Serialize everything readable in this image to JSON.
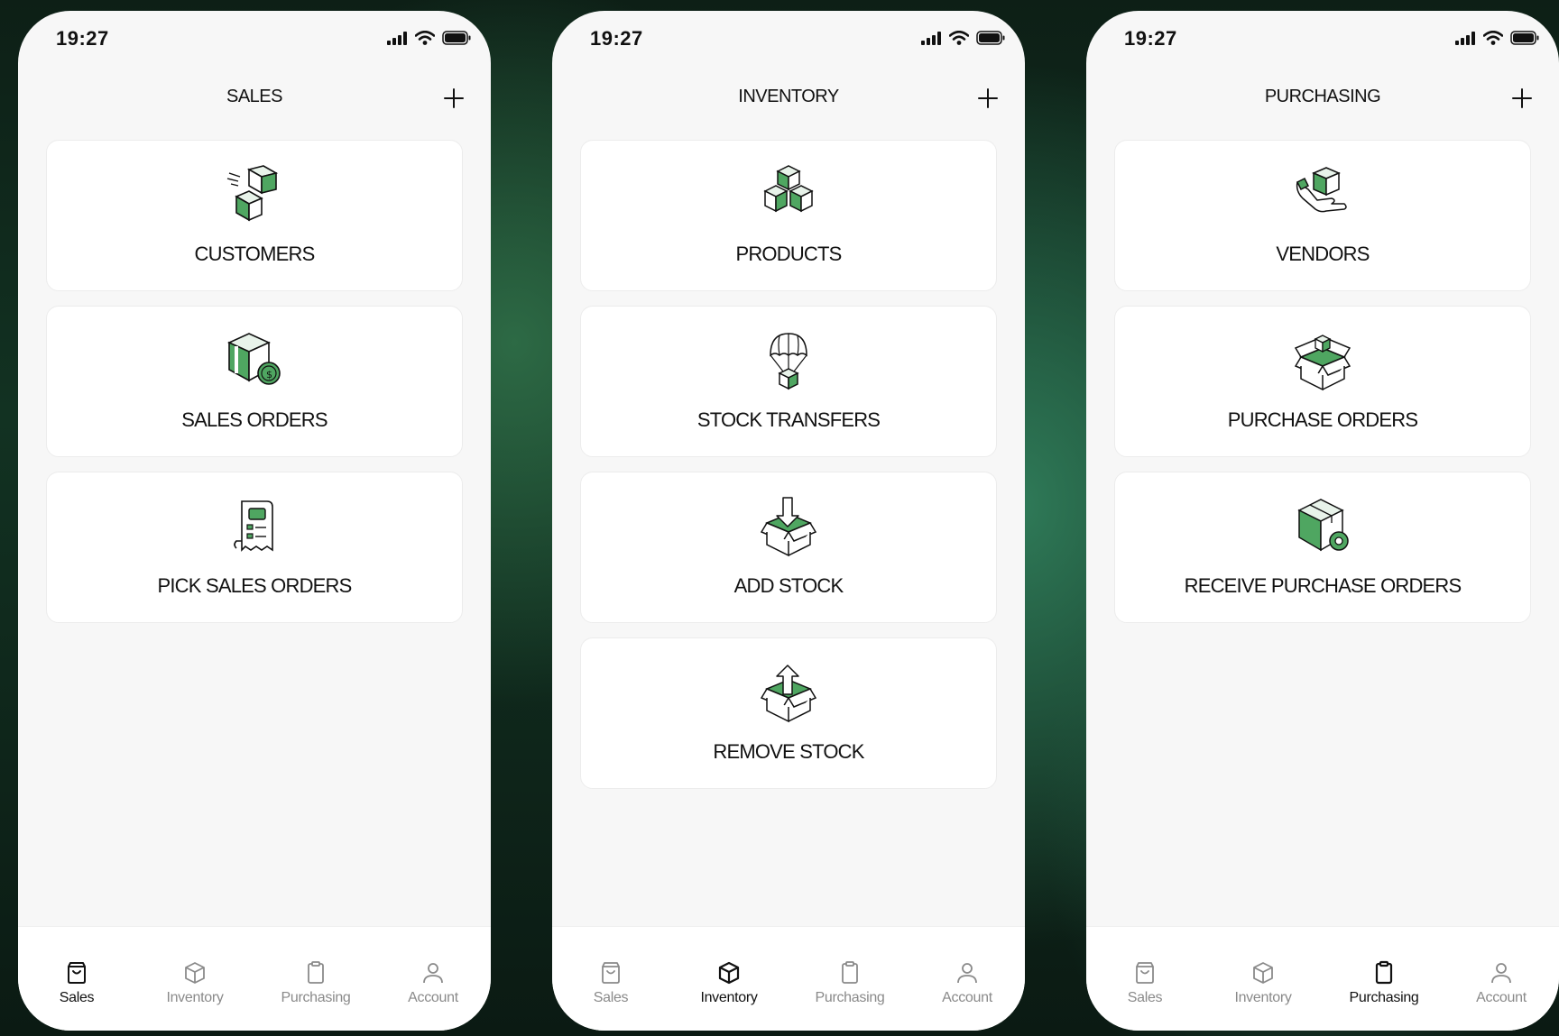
{
  "colors": {
    "accent_green": "#4fa661",
    "text": "#111111",
    "muted": "#8a8a8a"
  },
  "status_time": "19:27",
  "tabs": [
    "Sales",
    "Inventory",
    "Purchasing",
    "Account"
  ],
  "screens": [
    {
      "title": "SALES",
      "active_tab": "Sales",
      "cards": [
        {
          "label": "CUSTOMERS",
          "icon": "boxes-delivery-icon"
        },
        {
          "label": "SALES ORDERS",
          "icon": "box-coin-icon"
        },
        {
          "label": "PICK SALES ORDERS",
          "icon": "receipt-list-icon"
        }
      ]
    },
    {
      "title": "INVENTORY",
      "active_tab": "Inventory",
      "cards": [
        {
          "label": "PRODUCTS",
          "icon": "stacked-boxes-icon"
        },
        {
          "label": "STOCK TRANSFERS",
          "icon": "parachute-box-icon"
        },
        {
          "label": "ADD STOCK",
          "icon": "box-arrow-in-icon"
        },
        {
          "label": "REMOVE STOCK",
          "icon": "box-arrow-out-icon"
        }
      ]
    },
    {
      "title": "PURCHASING",
      "active_tab": "Purchasing",
      "cards": [
        {
          "label": "VENDORS",
          "icon": "hand-box-icon"
        },
        {
          "label": "PURCHASE ORDERS",
          "icon": "open-box-icon"
        },
        {
          "label": "RECEIVE PURCHASE ORDERS",
          "icon": "box-badge-icon"
        }
      ]
    }
  ]
}
